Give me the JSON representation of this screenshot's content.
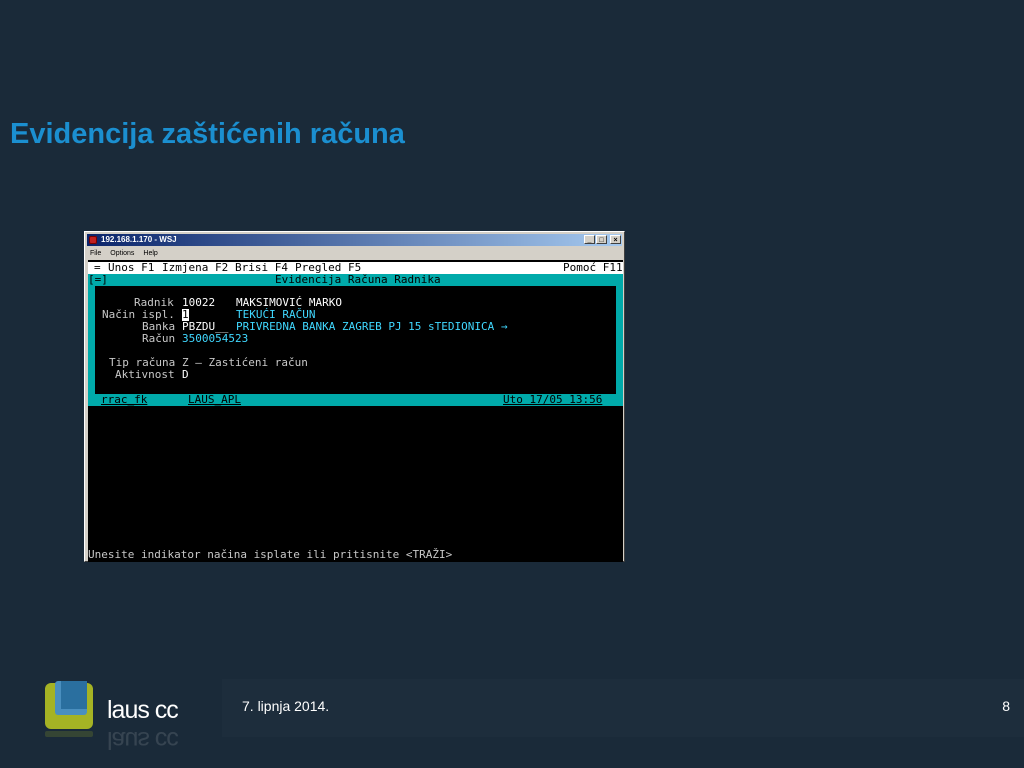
{
  "slide": {
    "title": "Evidencija zaštićenih računa",
    "footer_date": "7. lipnja 2014.",
    "page_number": "8",
    "logo_text": "laus cc"
  },
  "window": {
    "title": "192.168.1.170 - WSJ",
    "menu": [
      "File",
      "Options",
      "Help"
    ],
    "controls": {
      "minimize": "_",
      "maximize": "□",
      "close": "×"
    }
  },
  "terminal": {
    "menu": {
      "marker": "=",
      "unos": "Unos F1",
      "izmjena": "Izmjena F2",
      "brisi": "Brisi F4",
      "pregled": "Pregled F5",
      "pomoc": "Pomoć F11"
    },
    "header": {
      "marker": "[=]",
      "title": "Evidencija Računa Radnika"
    },
    "fields": {
      "radnik_label": "Radnik",
      "radnik_value": "10022",
      "radnik_name": "MAKSIMOVIĆ MARKO",
      "nacin_label": "Način ispl.",
      "nacin_value": "1",
      "nacin_desc": "TEKUĆI RAČUN",
      "banka_label": "Banka",
      "banka_value": "PBZDU__",
      "banka_desc": "PRIVREDNA BANKA ZAGREB PJ 15 sTEDIONICA →",
      "racun_label": "Račun",
      "racun_value": "3500054523",
      "tip_label": "Tip računa",
      "tip_value": "Z – Zastićeni račun",
      "aktivnost_label": "Aktivnost",
      "aktivnost_value": "D"
    },
    "status": {
      "form": "rrac_fk",
      "app": "LAUS_APL",
      "datetime": "Uto 17/05 13:56"
    },
    "prompt": "Unesite indikator načina isplate ili pritisnite <TRAŽI>"
  },
  "colors": {
    "title": "#1b8fd0",
    "terminal_cyan": "#00aaaa",
    "terminal_value_cyan": "#40d8ff",
    "background": "#1a2a39"
  }
}
